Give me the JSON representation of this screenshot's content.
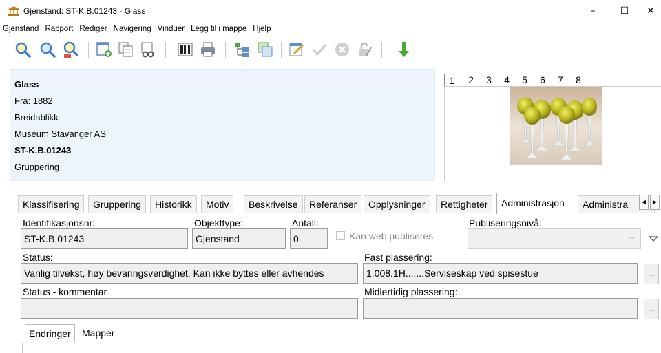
{
  "window": {
    "title": "Gjenstand: ST-K.B.01243  - Glass",
    "minimize": "–",
    "maximize": "☐",
    "close": "✕"
  },
  "menu": [
    "Gjenstand",
    "Rapport",
    "Rediger",
    "Navigering",
    "Vinduer",
    "Legg til i mappe",
    "Hjelp"
  ],
  "toolbar_icons": [
    "search-icon",
    "search-all-icon",
    "search-advanced-icon",
    "new-record-icon",
    "copy-record-icon",
    "link-icon",
    "barcode-icon",
    "print-icon",
    "tree-icon",
    "layers-icon",
    "edit-icon",
    "approve-icon",
    "cancel-icon",
    "unlock-icon",
    "arrow-down-icon"
  ],
  "info": {
    "name": "Glass",
    "from": "Fra:  1882",
    "place": "Breidablikk",
    "owner": "Museum Stavanger AS",
    "id": "ST-K.B.01243",
    "group": "Gruppering"
  },
  "image_tabs": [
    "1",
    "2",
    "3",
    "4",
    "5",
    "6",
    "7",
    "8"
  ],
  "tabs": [
    "Klassifisering",
    "Gruppering",
    "Historikk",
    "Motiv",
    "Beskrivelse",
    "Referanser",
    "Opplysninger",
    "Rettigheter",
    "Administrasjon",
    "Administra"
  ],
  "form": {
    "id_label": "Identifikasjonsnr:",
    "id_value": "ST-K.B.01243",
    "type_label": "Objekttype:",
    "type_value": "Gjenstand",
    "count_label": "Antall:",
    "count_value": "0",
    "web_label": "Kan web publiseres",
    "pub_label": "Publiseringsnivå:",
    "pub_value": "",
    "status_label": "Status:",
    "status_value": "Vanlig tilvekst, høy bevaringsverdighet. Kan ikke byttes eller avhendes",
    "fixed_label": "Fast plassering:",
    "fixed_value": "1.008.1H.......Serviseskap ved spisestue",
    "comment_label": "Status - kommentar",
    "comment_value": "",
    "temp_label": "Midlertidig plassering:",
    "temp_value": "",
    "dots": "..."
  },
  "bottom_tabs": [
    "Endringer",
    "Mapper"
  ],
  "colors": {
    "info_bg": "#eef4fb",
    "field_bg": "#efefef",
    "accent_green": "#46a832"
  }
}
